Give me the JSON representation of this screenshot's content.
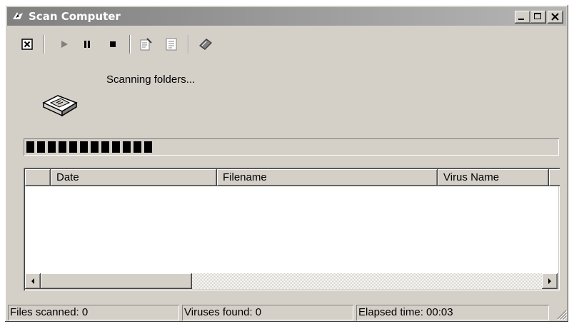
{
  "window": {
    "title": "Scan Computer",
    "controls": {
      "minimize": "_",
      "maximize": "□",
      "close": "×"
    }
  },
  "toolbar": {
    "buttons": [
      {
        "name": "close-scan",
        "icon": "close-box-icon"
      },
      {
        "name": "start",
        "icon": "play-icon"
      },
      {
        "name": "pause",
        "icon": "pause-icon"
      },
      {
        "name": "stop",
        "icon": "stop-icon"
      },
      {
        "name": "properties",
        "icon": "properties-icon"
      },
      {
        "name": "report",
        "icon": "report-icon"
      },
      {
        "name": "help",
        "icon": "help-book-icon"
      }
    ]
  },
  "scan": {
    "status_message": "Scanning folders...",
    "progress_blocks": 12
  },
  "results_table": {
    "columns": [
      "",
      "Date",
      "Filename",
      "Virus Name",
      ""
    ],
    "rows": []
  },
  "statusbar": {
    "files_scanned": "Files scanned: 0",
    "viruses_found": "Viruses found: 0",
    "elapsed_time": "Elapsed time: 00:03"
  }
}
